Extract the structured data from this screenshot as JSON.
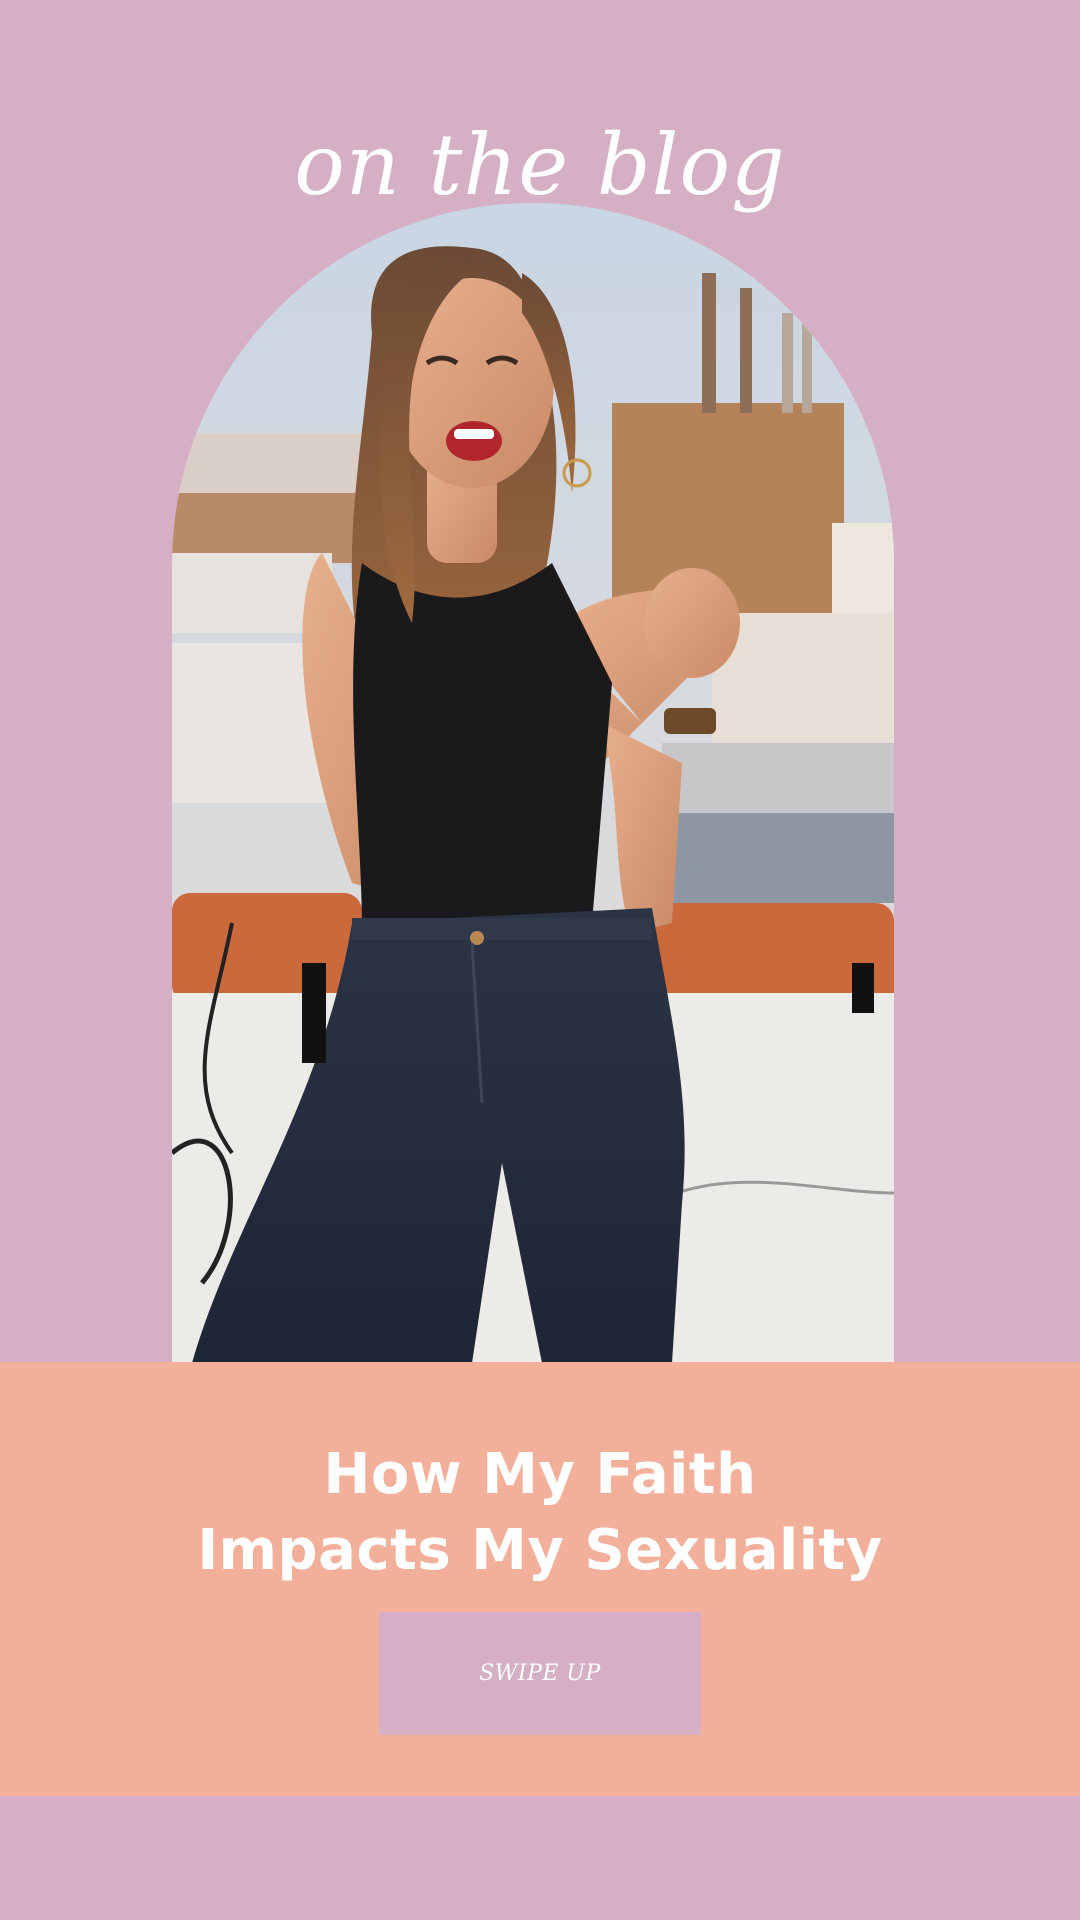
{
  "header": {
    "script_title": "on the blog"
  },
  "hero_photo": {
    "alt": "Smiling woman in a black tank top and dark jeans on a city rooftop"
  },
  "feature": {
    "headline_line1": "How My Faith",
    "headline_line2": "Impacts My Sexuality",
    "cta_label": "SWIPE UP"
  },
  "colors": {
    "background": "#d5b0c4",
    "band": "#f2b09a",
    "text": "#ffffff",
    "button": "#d5b0c4"
  }
}
